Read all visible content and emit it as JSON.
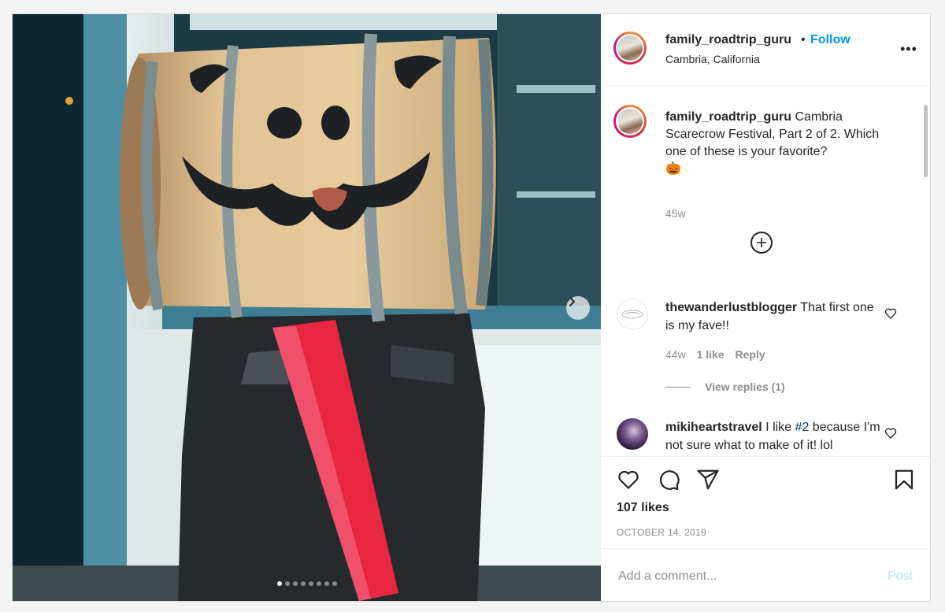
{
  "post": {
    "username": "family_roadtrip_guru",
    "follow_separator": "•",
    "follow_label": "Follow",
    "location": "Cambria, California",
    "more_label": "•••",
    "caption": {
      "username": "family_roadtrip_guru",
      "text": "Cambria Scarecrow Festival, Part 2 of 2. Which one of these is your favorite?",
      "emoji": "🎃",
      "age": "45w"
    },
    "load_more_icon": "plus-circle-icon",
    "comments": [
      {
        "username": "thewanderlustblogger",
        "text": "That first one is my fave!!",
        "age": "44w",
        "likes": "1 like",
        "reply_label": "Reply",
        "view_replies": "View replies (1)"
      },
      {
        "username": "mikiheartstravel",
        "text_before": "I like",
        "hashtag": "#2",
        "text_after": "because I'm not sure what to make of it! lol"
      }
    ],
    "likes": "107 likes",
    "date": "OCTOBER 14, 2019",
    "add_comment_placeholder": "Add a comment...",
    "post_button": "Post",
    "carousel": {
      "slide_count": 8,
      "active_index": 0
    }
  },
  "colors": {
    "accent": "#0095f6",
    "hashtag": "#00376b",
    "muted": "#8e8e8e",
    "post_disabled": "#b2dffc",
    "tie_red": "#e8263f"
  },
  "icons": [
    "heart-icon",
    "comment-icon",
    "share-icon",
    "bookmark-icon",
    "chevron-right-icon",
    "more-icon"
  ]
}
